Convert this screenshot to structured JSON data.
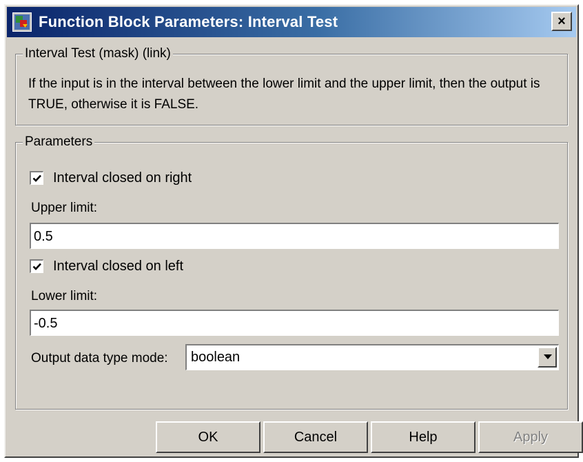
{
  "window": {
    "title": "Function Block Parameters: Interval Test",
    "close_glyph": "×",
    "icon": "simulink-app-icon"
  },
  "description": {
    "legend": "Interval Test (mask) (link)",
    "text": "If the input is in the interval between the lower limit and the upper limit, then the output is TRUE, otherwise it is FALSE."
  },
  "parameters": {
    "legend": "Parameters",
    "closed_right": {
      "label": "Interval closed on right",
      "checked": true
    },
    "upper_limit": {
      "label": "Upper limit:",
      "value": "0.5"
    },
    "closed_left": {
      "label": "Interval closed on left",
      "checked": true
    },
    "lower_limit": {
      "label": "Lower limit:",
      "value": "-0.5"
    },
    "output_mode": {
      "label": "Output data type mode:",
      "value": "boolean"
    }
  },
  "buttons": {
    "ok": "OK",
    "cancel": "Cancel",
    "help": "Help",
    "apply": "Apply"
  },
  "colors": {
    "face": "#d4d0c8",
    "title_start": "#0a246a",
    "title_end": "#a6caf0",
    "disabled_text": "#808080"
  }
}
